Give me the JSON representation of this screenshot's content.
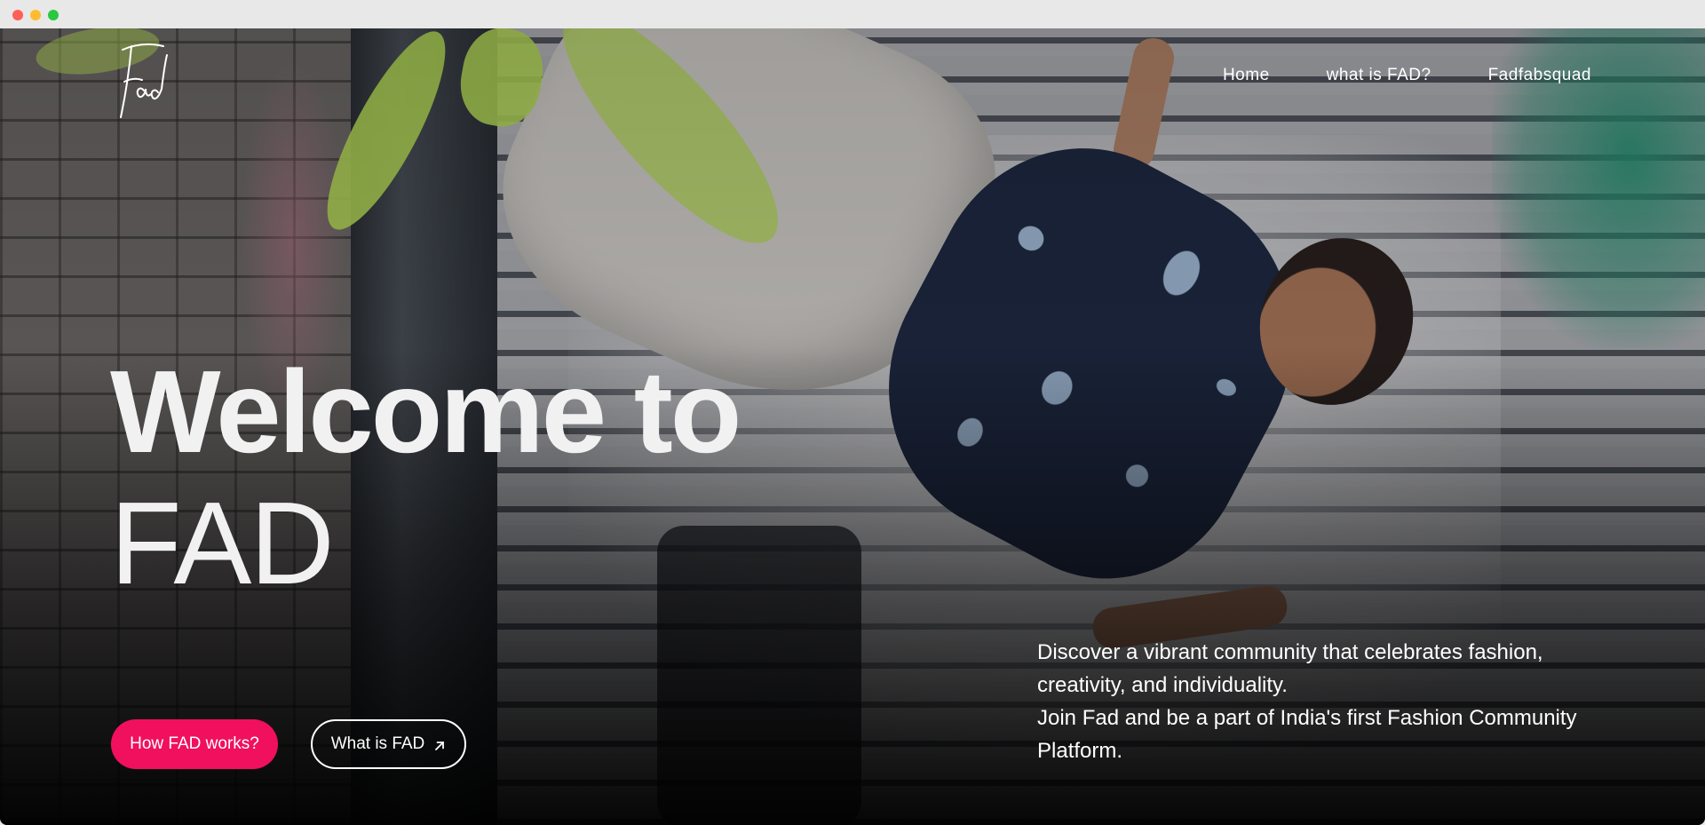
{
  "nav": {
    "items": [
      {
        "label": "Home"
      },
      {
        "label": "what is FAD?"
      },
      {
        "label": "Fadfabsquad"
      }
    ]
  },
  "logo": {
    "icon": "fad-script-logo-icon"
  },
  "hero": {
    "title_line1": "Welcome to",
    "title_line2": "FAD",
    "description_p1": "Discover a vibrant community that celebrates fashion, creativity, and individuality.",
    "description_p2": "Join Fad and be a part of India's first Fashion Community Platform."
  },
  "buttons": {
    "primary_label": "How FAD works?",
    "secondary_label": "What is FAD",
    "secondary_icon": "arrow-up-right-icon"
  },
  "colors": {
    "primary_button": "#f0105d",
    "text": "#ffffff"
  }
}
